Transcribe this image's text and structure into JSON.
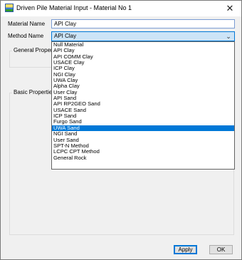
{
  "window": {
    "title": "Driven Pile Material Input  - Material No 1",
    "close_glyph": "✕",
    "icon": "app-icon"
  },
  "form": {
    "material_name_label": "Material Name",
    "material_name_value": "API Clay",
    "method_name_label": "Method Name",
    "method_name_value": "API Clay",
    "combo_arrow_glyph": "⌄"
  },
  "groups": {
    "general_properties_label": "General Properties",
    "basic_properties_label": "Basic Properties"
  },
  "dropdown": {
    "items": [
      "Null Material",
      "API Clay",
      "API COMM Clay",
      "USACE Clay",
      "ICP Clay",
      "NGI Clay",
      "UWA Clay",
      "Alpha Clay",
      "User Clay",
      "API Sand",
      "API RP2GEO Sand",
      "USACE Sand",
      "ICP Sand",
      "Furgo Sand",
      "UWA Sand",
      "NGI Sand",
      "User Sand",
      "SPT-N Method",
      "LCPC CPT Method",
      "General Rock"
    ],
    "highlighted_item": "UWA Sand"
  },
  "buttons": {
    "apply_label": "Apply",
    "ok_label": "OK"
  }
}
